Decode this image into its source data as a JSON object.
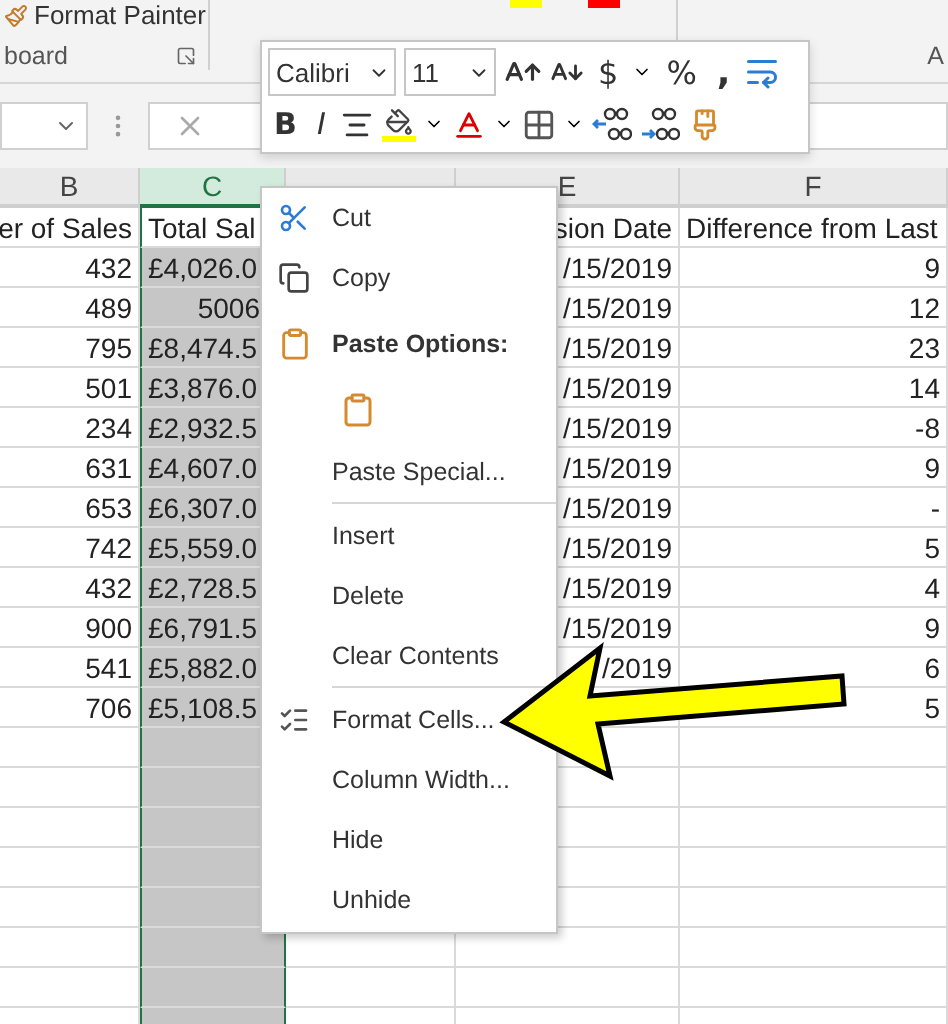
{
  "ribbon": {
    "button": "Format Painter",
    "group": "board",
    "next_group": "A"
  },
  "columns": [
    {
      "letter": "B",
      "selected": false
    },
    {
      "letter": "C",
      "selected": true
    },
    {
      "selected": false
    },
    {
      "letter": "E",
      "selected": false
    },
    {
      "letter": "F",
      "selected": false
    }
  ],
  "rows": [
    {
      "b": "er of Sales",
      "c": "Total Sal",
      "kind": "text",
      "e": "sion Date",
      "f": "Difference from Last",
      "active": true
    },
    {
      "b": "432",
      "c": "£4,026.0",
      "kind": "text",
      "e": "/15/2019",
      "f": "9",
      "active": false
    },
    {
      "b": "489",
      "c": "5006",
      "kind": "number",
      "e": "/15/2019",
      "f": "12",
      "active": false
    },
    {
      "b": "795",
      "c": "£8,474.5",
      "kind": "text",
      "e": "/15/2019",
      "f": "23",
      "active": false
    },
    {
      "b": "501",
      "c": "£3,876.0",
      "kind": "text",
      "e": "/15/2019",
      "f": "14",
      "active": false
    },
    {
      "b": "234",
      "c": "£2,932.5",
      "kind": "text",
      "e": "/15/2019",
      "f": "-8",
      "active": false
    },
    {
      "b": "631",
      "c": "£4,607.0",
      "kind": "text",
      "e": "/15/2019",
      "f": "9",
      "active": false
    },
    {
      "b": "653",
      "c": "£6,307.0",
      "kind": "text",
      "e": "/15/2019",
      "f": "-",
      "active": false
    },
    {
      "b": "742",
      "c": "£5,559.0",
      "kind": "text",
      "e": "/15/2019",
      "f": "5",
      "active": false
    },
    {
      "b": "432",
      "c": "£2,728.5",
      "kind": "text",
      "e": "/15/2019",
      "f": "4",
      "active": false
    },
    {
      "b": "900",
      "c": "£6,791.5",
      "kind": "text",
      "e": "/15/2019",
      "f": "9",
      "active": false
    },
    {
      "b": "541",
      "c": "£5,882.0",
      "kind": "text",
      "e": "/2019",
      "f": "6",
      "active": false
    },
    {
      "b": "706",
      "c": "£5,108.5",
      "kind": "text",
      "e": "",
      "f": "5",
      "active": false
    }
  ],
  "mini_toolbar": {
    "font": "Calibri",
    "size": "11",
    "currency": "$",
    "percent": "%",
    "comma": ",",
    "bold": "B",
    "italic": "I"
  },
  "context_menu": [
    {
      "kind": "item",
      "label": "Cut"
    },
    {
      "kind": "item",
      "label": "Copy"
    },
    {
      "kind": "heading",
      "label": "Paste Options:"
    },
    {
      "kind": "paste-button"
    },
    {
      "kind": "item",
      "label": "Paste Special..."
    },
    {
      "kind": "separator"
    },
    {
      "kind": "item",
      "label": "Insert"
    },
    {
      "kind": "item",
      "label": "Delete"
    },
    {
      "kind": "item",
      "label": "Clear Contents"
    },
    {
      "kind": "separator"
    },
    {
      "kind": "item",
      "label": "Format Cells..."
    },
    {
      "kind": "item",
      "label": "Column Width..."
    },
    {
      "kind": "item",
      "label": "Hide"
    },
    {
      "kind": "item",
      "label": "Unhide"
    }
  ]
}
